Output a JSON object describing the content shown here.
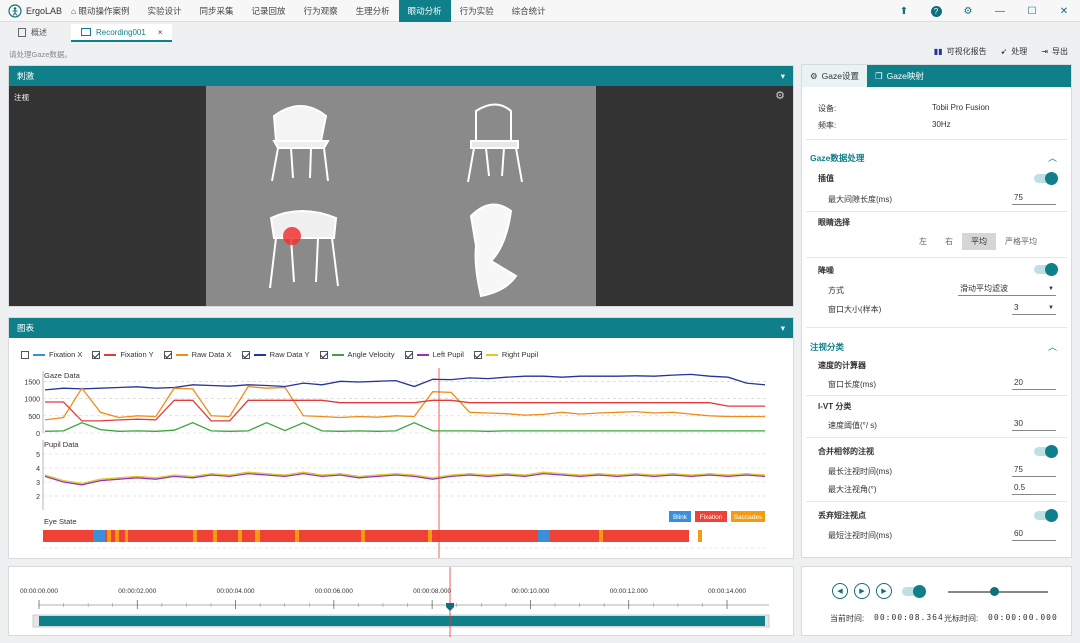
{
  "app": {
    "name": "ErgoLAB"
  },
  "menu": [
    "眼动操作案例",
    "实验设计",
    "同步采集",
    "记录回放",
    "行为观察",
    "生理分析",
    "眼动分析",
    "行为实验",
    "综合统计"
  ],
  "menu_active": "眼动分析",
  "tabs": {
    "overview": "概述",
    "recording": "Recording001",
    "close": "×"
  },
  "hint": "请处理Gaze数据。",
  "toolbar": {
    "report": "可视化报告",
    "process": "处理",
    "export": "导出"
  },
  "stimulus": {
    "title": "刺激",
    "label": "注视"
  },
  "chart_panel": {
    "title": "图表"
  },
  "legend": [
    {
      "label": "Fixation X",
      "checked": false,
      "color": "#3a8fd8"
    },
    {
      "label": "Fixation Y",
      "checked": true,
      "color": "#e23b3b"
    },
    {
      "label": "Raw Data X",
      "checked": true,
      "color": "#f08c1a"
    },
    {
      "label": "Raw Data Y",
      "checked": true,
      "color": "#25349a"
    },
    {
      "label": "Angle Velocity",
      "checked": true,
      "color": "#3aa53a"
    },
    {
      "label": "Left Pupil",
      "checked": true,
      "color": "#9b30b8"
    },
    {
      "label": "Right Pupil",
      "checked": true,
      "color": "#d9cc2a"
    }
  ],
  "chart_data": [
    {
      "type": "line",
      "title": "Gaze Data",
      "ylim": [
        0,
        1800
      ],
      "yticks": [
        "1500",
        "1000",
        "500",
        "0"
      ],
      "x": [
        0,
        1,
        2,
        3,
        4,
        5,
        6,
        7,
        8,
        9,
        10,
        11,
        12,
        13,
        14,
        15,
        16,
        17,
        18,
        19,
        20,
        21,
        22,
        23,
        24,
        25,
        26,
        27,
        28,
        29,
        30,
        31,
        32,
        33,
        34,
        35,
        36,
        37,
        38,
        39
      ],
      "series": [
        {
          "name": "Raw Data Y",
          "color": "#25349a",
          "values": [
            1250,
            1300,
            1280,
            1300,
            1320,
            1340,
            1300,
            1320,
            1400,
            1380,
            1360,
            1400,
            1380,
            1350,
            1450,
            1400,
            1500,
            1480,
            1500,
            1520,
            1350,
            1560,
            1550,
            1600,
            1580,
            1620,
            1650,
            1650,
            1620,
            1650,
            1650,
            1650,
            1660,
            1650,
            1680,
            1700,
            1650,
            1620,
            1450,
            1400
          ]
        },
        {
          "name": "Raw Data X",
          "color": "#f08c1a",
          "values": [
            380,
            450,
            1300,
            600,
            450,
            500,
            480,
            1300,
            1280,
            500,
            480,
            1350,
            1300,
            1320,
            500,
            480,
            450,
            480,
            460,
            500,
            480,
            1200,
            1180,
            600,
            580,
            560,
            520,
            540,
            600,
            550,
            580,
            600,
            620,
            580,
            600,
            550,
            500,
            480,
            480,
            480
          ]
        },
        {
          "name": "Fixation Y",
          "color": "#e23b3b",
          "values": [
            900,
            900,
            350,
            350,
            380,
            400,
            380,
            950,
            950,
            350,
            350,
            950,
            950,
            950,
            950,
            950,
            880,
            880,
            880,
            880,
            880,
            950,
            950,
            880,
            880,
            880,
            880,
            880,
            880,
            880,
            880,
            880,
            880,
            880,
            880,
            880,
            880,
            780,
            780,
            780
          ]
        },
        {
          "name": "Angle Velocity",
          "color": "#3aa53a",
          "values": [
            50,
            60,
            300,
            100,
            50,
            60,
            50,
            80,
            300,
            60,
            50,
            60,
            300,
            70,
            300,
            60,
            50,
            60,
            50,
            60,
            300,
            60,
            60,
            60,
            50,
            60,
            60,
            60,
            60,
            60,
            60,
            60,
            60,
            60,
            60,
            60,
            60,
            60,
            60,
            60
          ]
        }
      ]
    },
    {
      "type": "line",
      "title": "Pupil Data",
      "ylim": [
        1,
        6
      ],
      "yticks": [
        "5",
        "4",
        "3",
        "2"
      ],
      "x": [
        0,
        1,
        2,
        3,
        4,
        5,
        6,
        7,
        8,
        9,
        10,
        11,
        12,
        13,
        14,
        15,
        16,
        17,
        18,
        19,
        20,
        21,
        22,
        23,
        24,
        25,
        26,
        27,
        28,
        29,
        30,
        31,
        32,
        33,
        34,
        35,
        36,
        37,
        38,
        39
      ],
      "series": [
        {
          "name": "Left Pupil",
          "color": "#9b30b8",
          "values": [
            3.4,
            3.0,
            2.8,
            3.1,
            3.2,
            3.3,
            3.2,
            3.4,
            3.3,
            3.5,
            3.4,
            3.6,
            3.5,
            3.4,
            3.6,
            3.4,
            3.5,
            3.3,
            3.4,
            3.5,
            3.4,
            3.2,
            3.4,
            3.5,
            3.4,
            3.5,
            3.4,
            3.6,
            3.5,
            3.4,
            3.5,
            3.4,
            3.5,
            3.4,
            3.5,
            3.4,
            3.5,
            3.4,
            3.5,
            3.4
          ]
        },
        {
          "name": "Right Pupil",
          "color": "#d9cc2a",
          "values": [
            3.5,
            3.1,
            2.9,
            3.2,
            3.3,
            3.4,
            3.3,
            3.5,
            3.4,
            3.6,
            3.5,
            3.7,
            3.6,
            3.5,
            3.7,
            3.5,
            3.6,
            3.4,
            3.5,
            3.6,
            3.5,
            3.3,
            3.5,
            3.6,
            3.5,
            3.6,
            3.5,
            3.7,
            3.6,
            3.5,
            3.6,
            3.5,
            3.6,
            3.5,
            3.6,
            3.5,
            3.6,
            3.5,
            3.6,
            3.5
          ]
        }
      ]
    }
  ],
  "eye_state": {
    "title": "Eye State",
    "legend": [
      {
        "label": "Blink",
        "color": "#3a8fd8"
      },
      {
        "label": "Fixation",
        "color": "#ef4136"
      },
      {
        "label": "Saccades",
        "color": "#f39c12"
      }
    ]
  },
  "right_panel": {
    "tab_gaze": "Gaze设置",
    "tab_map": "Gaze映射",
    "device_label": "设备:",
    "device_value": "Tobii Pro Fusion",
    "freq_label": "频率:",
    "freq_value": "30Hz",
    "gaze_processing": "Gaze数据处理",
    "interp": "插值",
    "max_gap_label": "最大间隙长度(ms)",
    "max_gap": "75",
    "eye_select": "眼睛选择",
    "eye_options": [
      "左",
      "右",
      "平均",
      "严格平均"
    ],
    "eye_selected": "平均",
    "denoise": "降噪",
    "method_label": "方式",
    "method_value": "滑动平均滤波",
    "window_label": "窗口大小(样本)",
    "window_value": "3",
    "fix_class": "注视分类",
    "velocity_calc": "速度的计算器",
    "window_len_label": "窗口长度(ms)",
    "window_len": "20",
    "ivt": "I-VT 分类",
    "vel_thresh_label": "速度阈值(°/ s)",
    "vel_thresh": "30",
    "merge": "合并相邻的注视",
    "max_time_label": "最长注视时间(ms)",
    "max_time": "75",
    "max_angle_label": "最大注视角(°)",
    "max_angle": "0.5",
    "discard": "丢弃短注视点",
    "min_time_label": "最短注视时间(ms)",
    "min_time": "60"
  },
  "timeline": {
    "ticks": [
      "00:00:00.000",
      "00:00:02.000",
      "00:00:04.000",
      "00:00:06.000",
      "00:00:08.000",
      "00:00:10.000",
      "00:00:12.000",
      "00:00:14.000"
    ]
  },
  "playback": {
    "current_label": "当前时间:",
    "current_value": "00:00:08.364",
    "cursor_label": "光标时间:",
    "cursor_value": "00:00:00.000"
  }
}
